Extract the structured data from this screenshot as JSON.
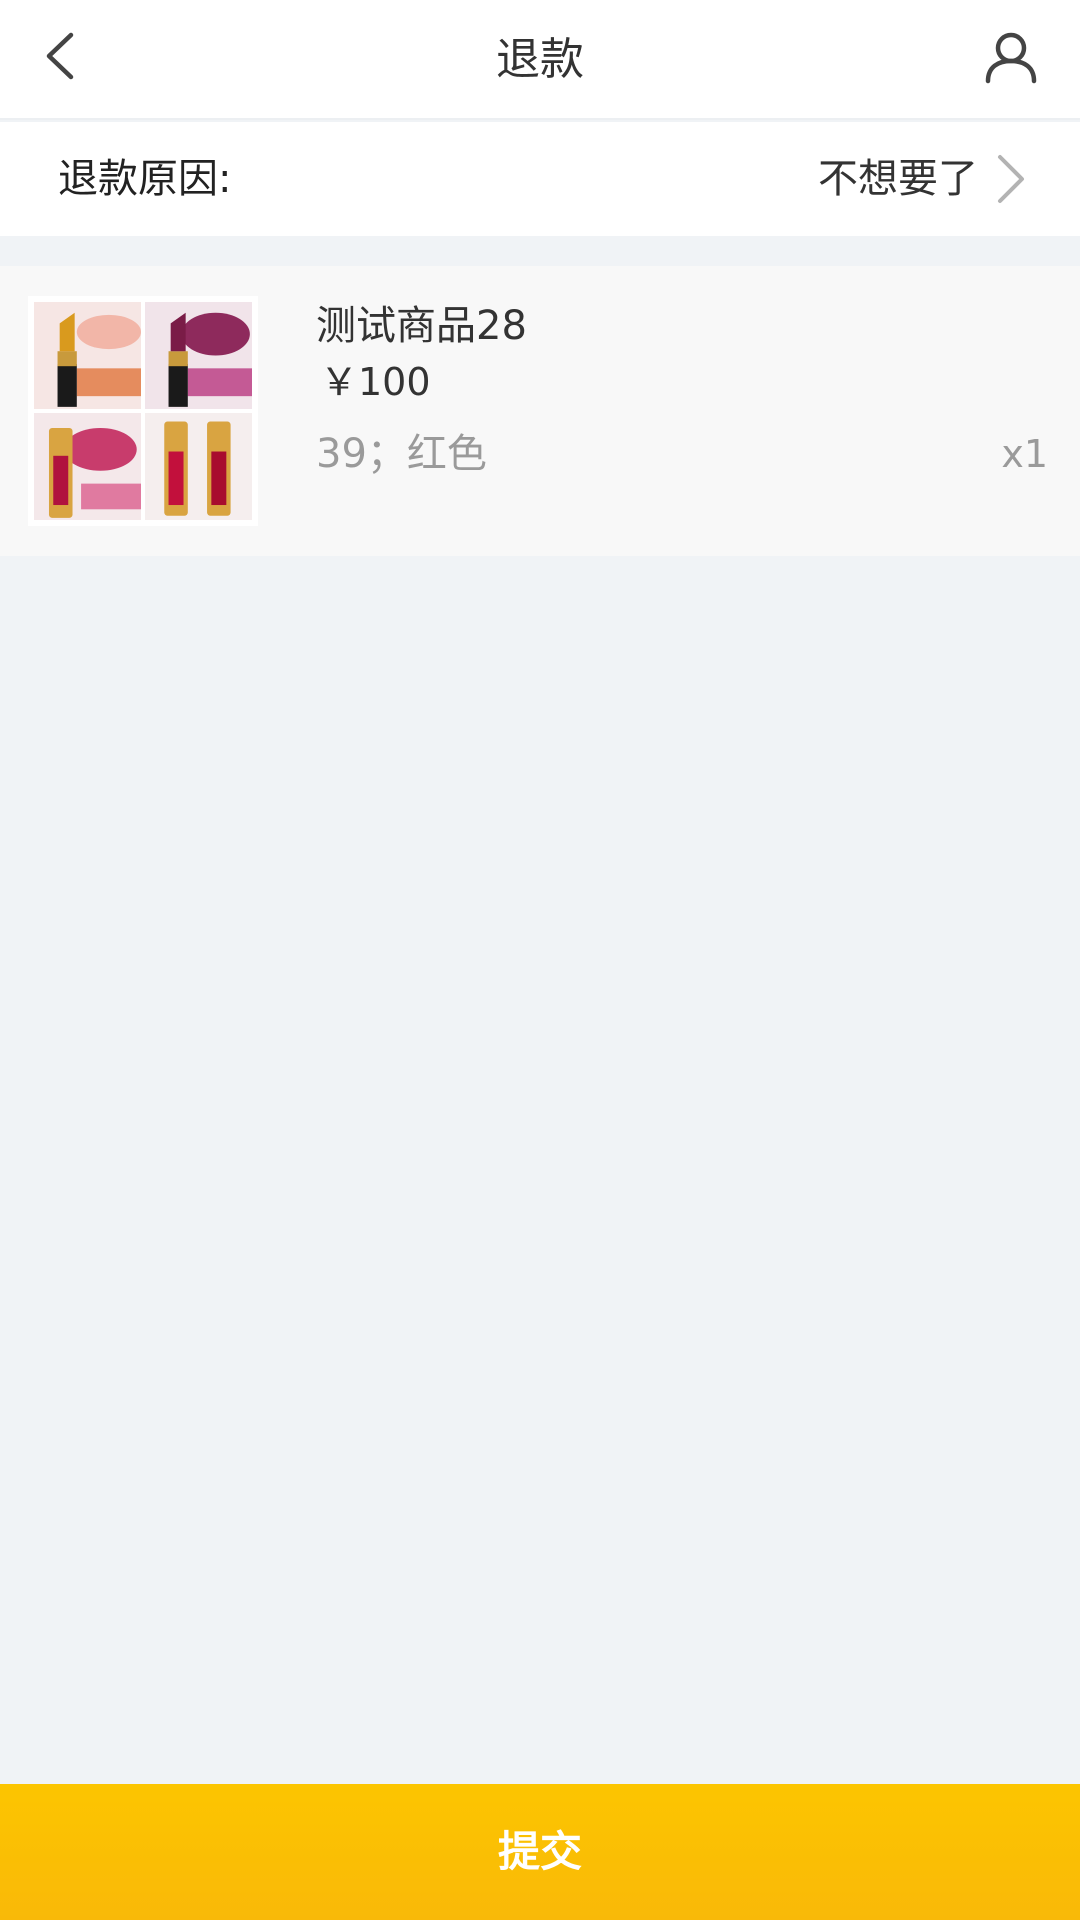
{
  "header": {
    "title": "退款",
    "back_icon": "chevron-left-icon",
    "user_icon": "user-icon"
  },
  "refund_reason": {
    "label": "退款原因:",
    "value": "不想要了",
    "chevron_icon": "chevron-right-icon"
  },
  "product": {
    "name": "测试商品28",
    "price": "￥100",
    "spec": "39；红色",
    "quantity": "x1",
    "image": "lipstick-product-image"
  },
  "submit": {
    "label": "提交",
    "color": "#fcc500"
  }
}
